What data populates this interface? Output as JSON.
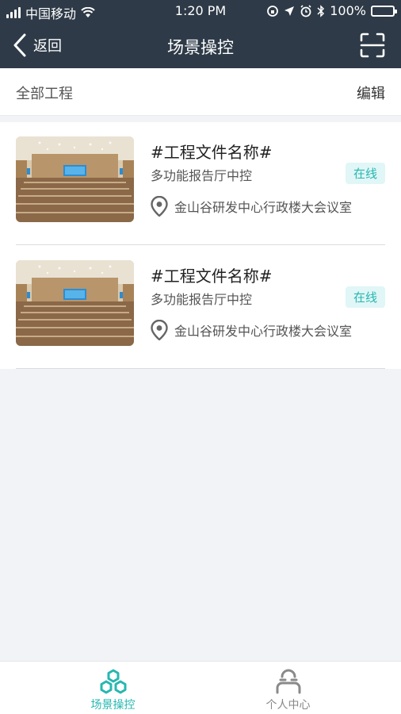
{
  "status_bar": {
    "carrier": "中国移动",
    "time": "1:20 PM",
    "battery": "100%"
  },
  "navbar": {
    "back_label": "返回",
    "title": "场景操控"
  },
  "filter": {
    "label": "全部工程",
    "edit_label": "编辑"
  },
  "projects": [
    {
      "name": "#工程文件名称#",
      "description": "多功能报告厅中控",
      "status": "在线",
      "location": "金山谷研发中心行政楼大会议室"
    },
    {
      "name": "#工程文件名称#",
      "description": "多功能报告厅中控",
      "status": "在线",
      "location": "金山谷研发中心行政楼大会议室"
    }
  ],
  "tabbar": {
    "tabs": [
      {
        "label": "场景操控",
        "icon": "hexagons-icon",
        "active": true
      },
      {
        "label": "个人中心",
        "icon": "person-icon",
        "active": false
      }
    ]
  },
  "colors": {
    "header_bg": "#2e3a47",
    "accent": "#26b7b0",
    "badge_bg": "#e1f6f6"
  }
}
